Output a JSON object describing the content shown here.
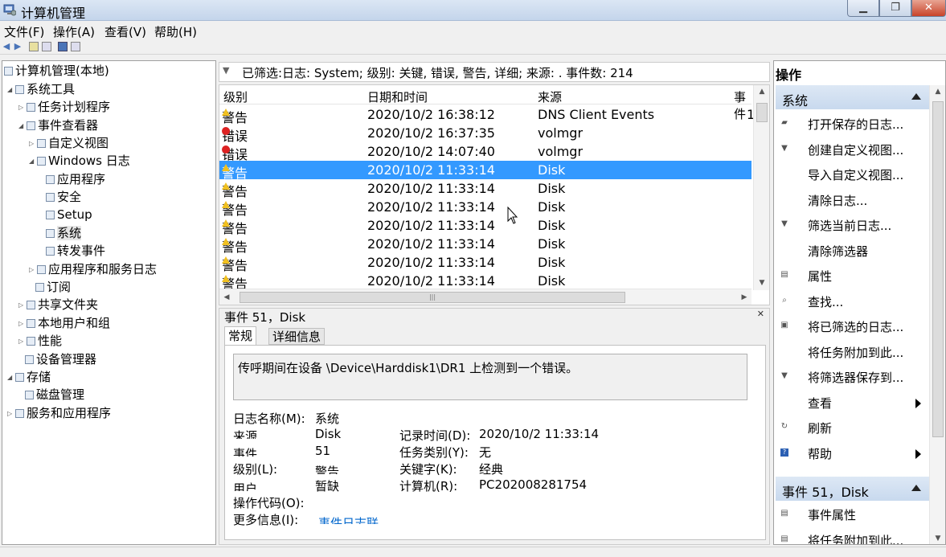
{
  "window": {
    "title": "计算机管理"
  },
  "menu": [
    "文件(F)",
    "操作(A)",
    "查看(V)",
    "帮助(H)"
  ],
  "tree": {
    "items": [
      {
        "label": "计算机管理(本地)"
      },
      {
        "label": "系统工具"
      },
      {
        "label": "任务计划程序"
      },
      {
        "label": "事件查看器"
      },
      {
        "label": "自定义视图"
      },
      {
        "label": "Windows 日志"
      },
      {
        "label": "应用程序"
      },
      {
        "label": "安全"
      },
      {
        "label": "Setup"
      },
      {
        "label": "系统"
      },
      {
        "label": "转发事件"
      },
      {
        "label": "应用程序和服务日志"
      },
      {
        "label": "订阅"
      },
      {
        "label": "共享文件夹"
      },
      {
        "label": "本地用户和组"
      },
      {
        "label": "性能"
      },
      {
        "label": "设备管理器"
      },
      {
        "label": "存储"
      },
      {
        "label": "磁盘管理"
      },
      {
        "label": "服务和应用程序"
      }
    ]
  },
  "filter": {
    "text": "已筛选:日志: System; 级别: 关键, 错误, 警告, 详细; 来源: . 事件数: 214"
  },
  "list": {
    "columns": [
      "级别",
      "日期和时间",
      "来源",
      "事件"
    ],
    "rows": [
      {
        "level": "警告",
        "type": "warn",
        "datetime": "2020/10/2 16:38:12",
        "source": "DNS Client Events",
        "id": "1"
      },
      {
        "level": "错误",
        "type": "err",
        "datetime": "2020/10/2 16:37:35",
        "source": "volmgr",
        "id": ""
      },
      {
        "level": "错误",
        "type": "err",
        "datetime": "2020/10/2 14:07:40",
        "source": "volmgr",
        "id": ""
      },
      {
        "level": "警告",
        "type": "warn",
        "datetime": "2020/10/2 11:33:14",
        "source": "Disk",
        "id": ""
      },
      {
        "level": "警告",
        "type": "warn",
        "datetime": "2020/10/2 11:33:14",
        "source": "Disk",
        "id": ""
      },
      {
        "level": "警告",
        "type": "warn",
        "datetime": "2020/10/2 11:33:14",
        "source": "Disk",
        "id": ""
      },
      {
        "level": "警告",
        "type": "warn",
        "datetime": "2020/10/2 11:33:14",
        "source": "Disk",
        "id": ""
      },
      {
        "level": "警告",
        "type": "warn",
        "datetime": "2020/10/2 11:33:14",
        "source": "Disk",
        "id": ""
      },
      {
        "level": "警告",
        "type": "warn",
        "datetime": "2020/10/2 11:33:14",
        "source": "Disk",
        "id": ""
      },
      {
        "level": "警告",
        "type": "warn",
        "datetime": "2020/10/2 11:33:14",
        "source": "Disk",
        "id": ""
      }
    ]
  },
  "detail": {
    "title": "事件 51，Disk",
    "tabs": [
      "常规",
      "详细信息"
    ],
    "message": "传呼期间在设备 \\Device\\Harddisk1\\DR1 上检测到一个错误。",
    "log_name_label": "日志名称(M):",
    "log_name_value": "系统",
    "source_label": "来源",
    "source_value": "Disk",
    "event_id_label": "事件",
    "event_id_value": "51",
    "level_label": "级别(L):",
    "level_value": "警告",
    "user_label": "用户",
    "user_value": "暂缺",
    "opcode_label": "操作代码(O):",
    "more_info_label": "更多信息(I):",
    "more_info_link": "事件日志联",
    "logged_label": "记录时间(D):",
    "logged_value": "2020/10/2 11:33:14",
    "task_label": "任务类别(Y):",
    "task_value": "无",
    "keywords_label": "关键字(K):",
    "keywords_value": "经典",
    "computer_label": "计算机(R):",
    "computer_value": "PC202008281754"
  },
  "actions": {
    "header": "操作",
    "section1": "系统",
    "items1": [
      {
        "label": "打开保存的日志...",
        "icon": "folder-icon"
      },
      {
        "label": "创建自定义视图...",
        "icon": "filter-icon"
      },
      {
        "label": "导入自定义视图...",
        "icon": ""
      },
      {
        "label": "清除日志...",
        "icon": ""
      },
      {
        "label": "筛选当前日志...",
        "icon": "filter-icon"
      },
      {
        "label": "清除筛选器",
        "icon": ""
      },
      {
        "label": "属性",
        "icon": "properties-icon"
      },
      {
        "label": "查找...",
        "icon": "find-icon"
      },
      {
        "label": "将已筛选的日志...",
        "icon": "save-icon"
      },
      {
        "label": "将任务附加到此...",
        "icon": ""
      },
      {
        "label": "将筛选器保存到...",
        "icon": "filter-save-icon"
      },
      {
        "label": "查看",
        "icon": ""
      },
      {
        "label": "刷新",
        "icon": "refresh-icon"
      },
      {
        "label": "帮助",
        "icon": "help-icon"
      }
    ],
    "section2": "事件 51，Disk",
    "items2": [
      {
        "label": "事件属性",
        "icon": "properties-icon"
      },
      {
        "label": "将任务附加到此...",
        "icon": "task-icon"
      }
    ]
  }
}
